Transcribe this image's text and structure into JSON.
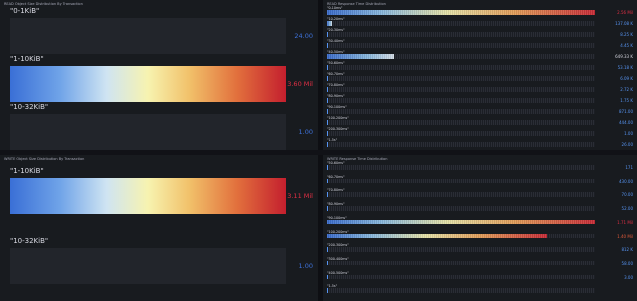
{
  "read_size": {
    "title": "READ Object Size Distribution By Transaction",
    "rows": [
      {
        "label": "\"0-1KiB\"",
        "value": "24.00",
        "fill": 0.0,
        "color": "#3d71d9"
      },
      {
        "label": "\"1-10KiB\"",
        "value": "3.60 Mil",
        "fill": 1.0,
        "color": "#e02f44"
      },
      {
        "label": "\"10-32KiB\"",
        "value": "1.00",
        "fill": 0.0,
        "color": "#3d71d9"
      }
    ]
  },
  "read_rt": {
    "title": "READ Response Time Distribution",
    "rows": [
      {
        "label": "\"0-10ms\"",
        "value": "2.56 Mil",
        "fill": 1.0,
        "color": "#e02f44"
      },
      {
        "label": "\"10-20ms\"",
        "value": "137.08 K",
        "fill": 0.02,
        "color": "#5794f2"
      },
      {
        "label": "\"20-30ms\"",
        "value": "8.25 K",
        "fill": 0.0,
        "color": "#5794f2"
      },
      {
        "label": "\"30-40ms\"",
        "value": "4.45 K",
        "fill": 0.0,
        "color": "#5794f2"
      },
      {
        "label": "\"40-50ms\"",
        "value": "649.33 K",
        "fill": 0.25,
        "color": "#d8d9e2"
      },
      {
        "label": "\"50-60ms\"",
        "value": "53.18 K",
        "fill": 0.0,
        "color": "#5794f2"
      },
      {
        "label": "\"60-70ms\"",
        "value": "6.09 K",
        "fill": 0.0,
        "color": "#5794f2"
      },
      {
        "label": "\"70-80ms\"",
        "value": "2.72 K",
        "fill": 0.0,
        "color": "#5794f2"
      },
      {
        "label": "\"80-90ms\"",
        "value": "1.75 K",
        "fill": 0.0,
        "color": "#5794f2"
      },
      {
        "label": "\"90-100ms\"",
        "value": "871.00",
        "fill": 0.0,
        "color": "#5794f2"
      },
      {
        "label": "\"100-200ms\"",
        "value": "444.00",
        "fill": 0.0,
        "color": "#5794f2"
      },
      {
        "label": "\"200-300ms\"",
        "value": "1.00",
        "fill": 0.0,
        "color": "#5794f2"
      },
      {
        "label": "\"1-5s\"",
        "value": "26.00",
        "fill": 0.0,
        "color": "#5794f2"
      }
    ]
  },
  "write_size": {
    "title": "WRITE Object Size Distribution By Transaction",
    "rows": [
      {
        "label": "\"1-10KiB\"",
        "value": "3.11 Mil",
        "fill": 1.0,
        "color": "#e02f44"
      },
      {
        "label": "\"10-32KiB\"",
        "value": "1.00",
        "fill": 0.0,
        "color": "#3d71d9"
      }
    ]
  },
  "write_rt": {
    "title": "WRITE Response Time Distribution",
    "rows": [
      {
        "label": "\"50-60ms\"",
        "value": "171",
        "fill": 0.0,
        "color": "#5794f2"
      },
      {
        "label": "\"60-70ms\"",
        "value": "430.00",
        "fill": 0.0,
        "color": "#5794f2"
      },
      {
        "label": "\"70-80ms\"",
        "value": "70.00",
        "fill": 0.0,
        "color": "#5794f2"
      },
      {
        "label": "\"80-90ms\"",
        "value": "52.00",
        "fill": 0.0,
        "color": "#5794f2"
      },
      {
        "label": "\"90-100ms\"",
        "value": "1.71 Mil",
        "fill": 1.0,
        "color": "#e02f44"
      },
      {
        "label": "\"100-200ms\"",
        "value": "1.40 Mil",
        "fill": 0.82,
        "color": "#e05a3a"
      },
      {
        "label": "\"200-300ms\"",
        "value": "812 K",
        "fill": 0.0,
        "color": "#5794f2"
      },
      {
        "label": "\"300-400ms\"",
        "value": "58.00",
        "fill": 0.0,
        "color": "#5794f2"
      },
      {
        "label": "\"400-500ms\"",
        "value": "3.00",
        "fill": 0.0,
        "color": "#5794f2"
      },
      {
        "label": "\"1-5s\"",
        "value": "",
        "fill": 0.0,
        "color": "#5794f2"
      }
    ]
  }
}
